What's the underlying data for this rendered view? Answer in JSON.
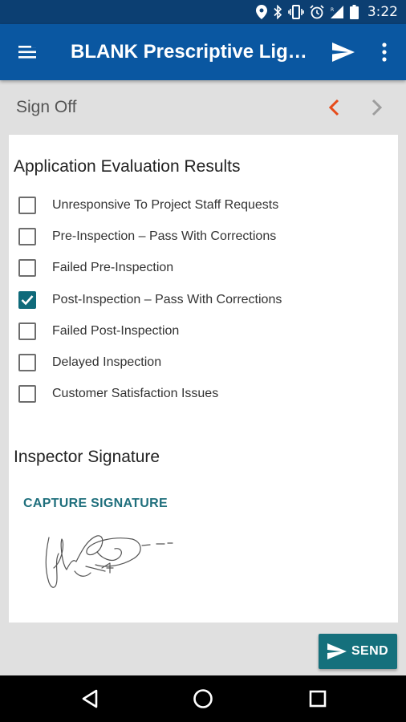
{
  "status_bar": {
    "time": "3:22",
    "icons": [
      "location-icon",
      "bluetooth-icon",
      "vibrate-icon",
      "alarm-icon",
      "signal-icon",
      "battery-icon"
    ]
  },
  "app_bar": {
    "title": "BLANK Prescriptive Lighting",
    "icons": {
      "menu": "menu-icon",
      "send": "send-icon",
      "more": "more-vert-icon"
    }
  },
  "section": {
    "title": "Sign Off",
    "prev_icon": "chevron-left-icon",
    "next_icon": "chevron-right-icon",
    "accent_color": "#e64a19"
  },
  "evaluation": {
    "heading": "Application Evaluation Results",
    "items": [
      {
        "label": "Unresponsive To Project Staff Requests",
        "checked": false
      },
      {
        "label": "Pre-Inspection – Pass With Corrections",
        "checked": false
      },
      {
        "label": "Failed Pre-Inspection",
        "checked": false
      },
      {
        "label": "Post-Inspection – Pass With Corrections",
        "checked": true
      },
      {
        "label": "Failed Post-Inspection",
        "checked": false
      },
      {
        "label": "Delayed Inspection",
        "checked": false
      },
      {
        "label": "Customer Satisfaction Issues",
        "checked": false
      }
    ]
  },
  "signature": {
    "heading": "Inspector Signature",
    "capture_label": "CAPTURE SIGNATURE"
  },
  "send_button": {
    "label": "SEND",
    "color": "#15707c"
  },
  "nav_bar": {
    "icons": [
      "back-icon",
      "home-icon",
      "recents-icon"
    ]
  }
}
